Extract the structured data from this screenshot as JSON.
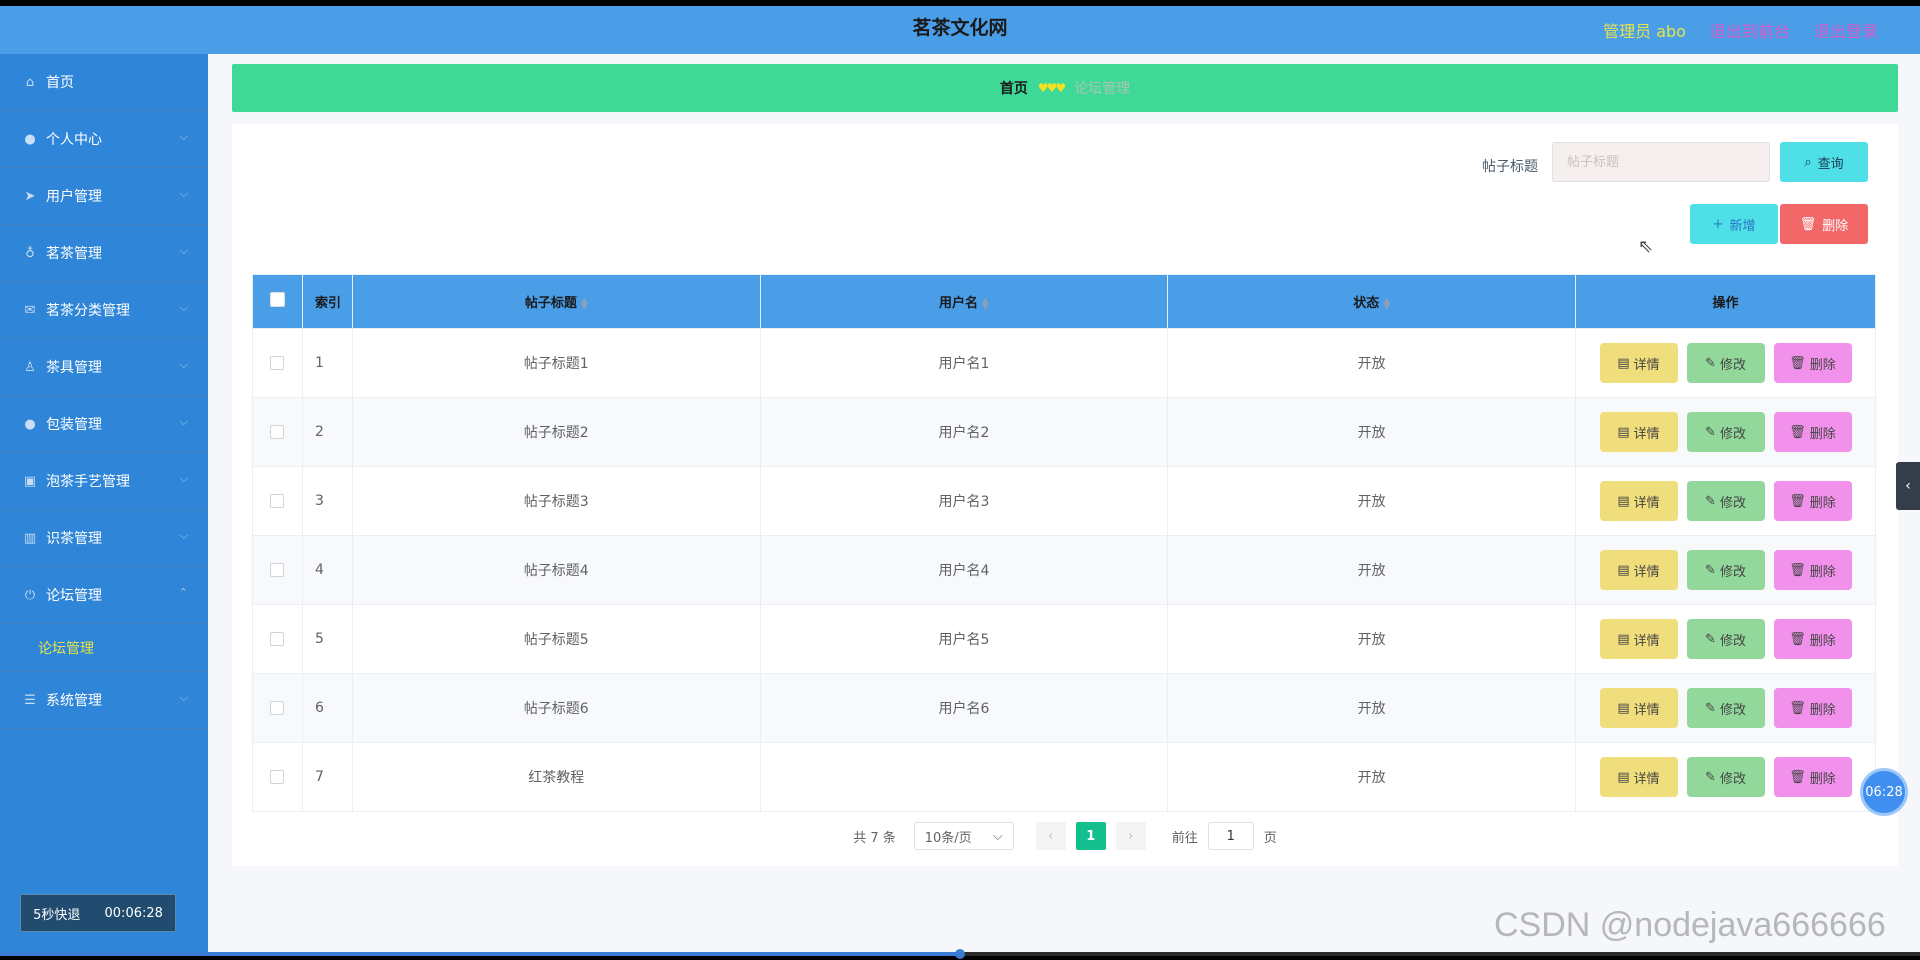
{
  "header": {
    "title": "茗茶文化网",
    "admin": "管理员 abo",
    "back_link": "退出到前台",
    "logout_link": "退出登录"
  },
  "sidebar": {
    "items": [
      {
        "label": "首页",
        "icon": "home-icon",
        "chevron": false
      },
      {
        "label": "个人中心",
        "icon": "user-icon",
        "chevron": true
      },
      {
        "label": "用户管理",
        "icon": "send-icon",
        "chevron": true
      },
      {
        "label": "茗茶管理",
        "icon": "microphone-icon",
        "chevron": true
      },
      {
        "label": "茗茶分类管理",
        "icon": "mail-icon",
        "chevron": true
      },
      {
        "label": "茶具管理",
        "icon": "cup-icon",
        "chevron": true
      },
      {
        "label": "包装管理",
        "icon": "user-icon",
        "chevron": true
      },
      {
        "label": "泡茶手艺管理",
        "icon": "picture-icon",
        "chevron": true
      },
      {
        "label": "识茶管理",
        "icon": "chart-icon",
        "chevron": true
      },
      {
        "label": "论坛管理",
        "icon": "power-icon",
        "chevron": true,
        "expanded": true
      }
    ],
    "submenu_label": "论坛管理",
    "system_label": "系统管理",
    "quit_label": "5秒快退",
    "quit_time": "00:06:28"
  },
  "breadcrumb": {
    "home": "首页",
    "current": "论坛管理"
  },
  "search": {
    "label": "帖子标题",
    "placeholder": "帖子标题",
    "query_button": "查询"
  },
  "actions": {
    "add_button": "新增",
    "delete_button": "删除"
  },
  "table": {
    "headers": {
      "index": "索引",
      "title": "帖子标题",
      "user": "用户名",
      "status": "状态",
      "ops": "操作"
    },
    "rows": [
      {
        "index": "1",
        "title": "帖子标题1",
        "user": "用户名1",
        "status": "开放"
      },
      {
        "index": "2",
        "title": "帖子标题2",
        "user": "用户名2",
        "status": "开放"
      },
      {
        "index": "3",
        "title": "帖子标题3",
        "user": "用户名3",
        "status": "开放"
      },
      {
        "index": "4",
        "title": "帖子标题4",
        "user": "用户名4",
        "status": "开放"
      },
      {
        "index": "5",
        "title": "帖子标题5",
        "user": "用户名5",
        "status": "开放"
      },
      {
        "index": "6",
        "title": "帖子标题6",
        "user": "用户名6",
        "status": "开放"
      },
      {
        "index": "7",
        "title": "红茶教程",
        "user": "",
        "status": "开放"
      }
    ],
    "op_labels": {
      "detail": "详情",
      "edit": "修改",
      "delete": "删除"
    }
  },
  "pagination": {
    "total": "共 7 条",
    "page_size": "10条/页",
    "current_page": "1",
    "goto_label": "前往",
    "goto_value": "1",
    "page_suffix": "页"
  },
  "overlay": {
    "timer": "06:28",
    "watermark": "CSDN @nodejava666666",
    "video_progress": 0.5
  },
  "colors": {
    "header": "#4a9ee8",
    "sidebar": "#2f86d8",
    "breadcrumb": "#3fd997",
    "accent_yellow": "#e6e34a",
    "link_pink": "#d55ac8",
    "page_active": "#13c08d"
  }
}
